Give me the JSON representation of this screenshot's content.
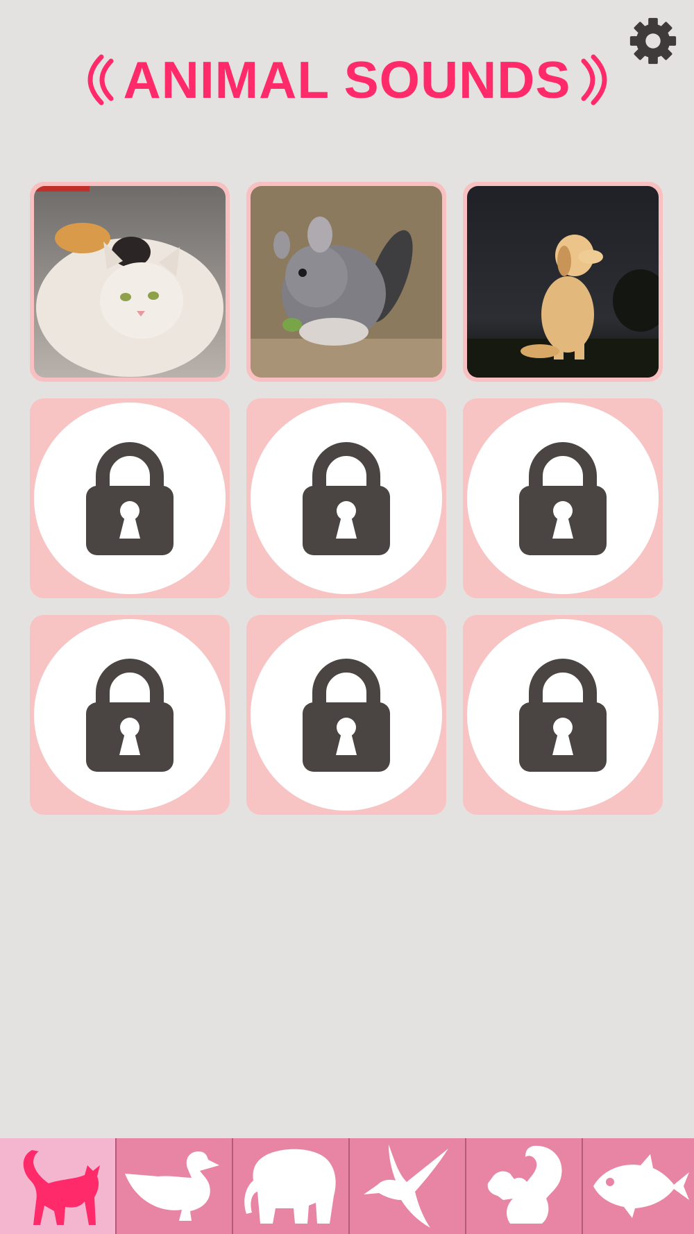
{
  "app": {
    "title": "ANIMAL SOUNDS"
  },
  "colors": {
    "accent": "#ff2a6a",
    "background": "#e4e2e1",
    "tile": "#f8c4c3",
    "lock": "#4a4542",
    "tabbar": "#e884a4",
    "tab_active": "#f4b5cf"
  },
  "header": {
    "settings_icon": "gear-icon"
  },
  "grid": {
    "tiles": [
      {
        "type": "photo",
        "animal": "cat"
      },
      {
        "type": "photo",
        "animal": "chinchilla"
      },
      {
        "type": "photo",
        "animal": "dog"
      },
      {
        "type": "locked"
      },
      {
        "type": "locked"
      },
      {
        "type": "locked"
      },
      {
        "type": "locked"
      },
      {
        "type": "locked"
      },
      {
        "type": "locked"
      }
    ]
  },
  "tabs": [
    {
      "category": "cat",
      "icon": "cat-icon",
      "active": true
    },
    {
      "category": "duck",
      "icon": "duck-icon",
      "active": false
    },
    {
      "category": "elephant",
      "icon": "elephant-icon",
      "active": false
    },
    {
      "category": "bird",
      "icon": "bird-icon",
      "active": false
    },
    {
      "category": "squirrel",
      "icon": "squirrel-icon",
      "active": false
    },
    {
      "category": "fish",
      "icon": "fish-icon",
      "active": false
    }
  ]
}
